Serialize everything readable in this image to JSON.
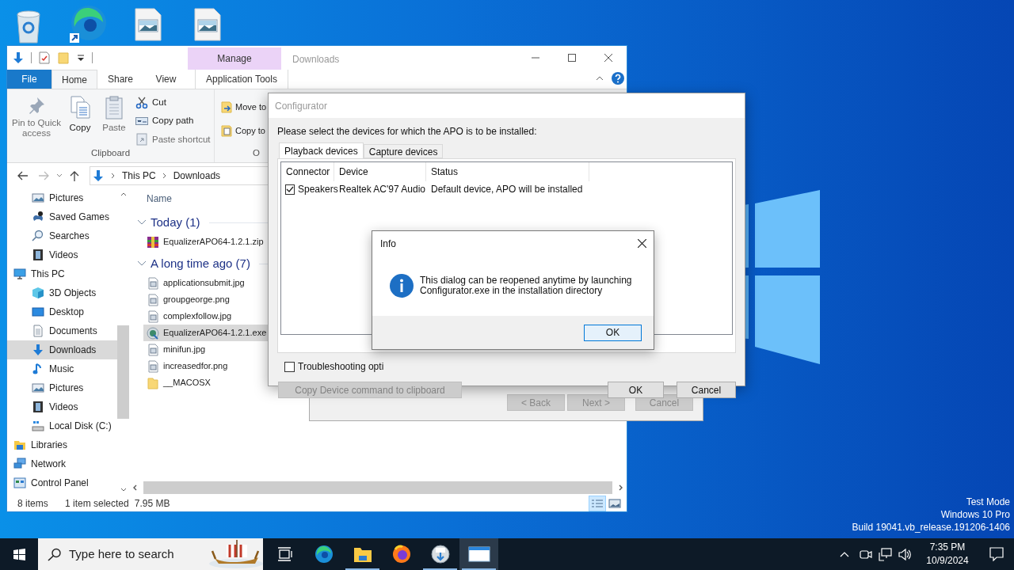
{
  "desktop": {
    "system_info": [
      "Test Mode",
      "Windows 10 Pro",
      "Build 19041.vb_release.191206-1406"
    ]
  },
  "explorer": {
    "title": "Downloads",
    "context_header": "Manage",
    "tabs": [
      {
        "label": "File",
        "kind": "file",
        "selected": false
      },
      {
        "label": "Home",
        "kind": "tab",
        "selected": true
      },
      {
        "label": "Share",
        "kind": "tab",
        "selected": false
      },
      {
        "label": "View",
        "kind": "tab",
        "selected": false
      },
      {
        "label": "Application Tools",
        "kind": "context",
        "selected": false
      }
    ],
    "ribbon": {
      "clipboard": {
        "label": "Clipboard",
        "commands": [
          {
            "label": "Pin to Quick access",
            "kind": "large",
            "disabled": true
          },
          {
            "label": "Copy",
            "kind": "large",
            "disabled": false
          },
          {
            "label": "Paste",
            "kind": "large",
            "disabled": true
          },
          {
            "label": "Cut",
            "kind": "small",
            "disabled": false
          },
          {
            "label": "Copy path",
            "kind": "small",
            "disabled": false
          },
          {
            "label": "Paste shortcut",
            "kind": "small",
            "disabled": true
          }
        ]
      },
      "organize": {
        "label": "O",
        "commands": [
          {
            "label": "Move to",
            "disabled": false
          },
          {
            "label": "Copy to",
            "disabled": false
          }
        ]
      }
    },
    "address": [
      "This PC",
      "Downloads"
    ],
    "nav": {
      "items_under_hidden_parent": [
        {
          "label": "Pictures",
          "selected": false
        },
        {
          "label": "Saved Games",
          "selected": false
        },
        {
          "label": "Searches",
          "selected": false
        },
        {
          "label": "Videos",
          "selected": false
        }
      ],
      "items": [
        {
          "label": "This PC",
          "selected": false,
          "children": [
            {
              "label": "3D Objects",
              "selected": false
            },
            {
              "label": "Desktop",
              "selected": false
            },
            {
              "label": "Documents",
              "selected": false
            },
            {
              "label": "Downloads",
              "selected": true
            },
            {
              "label": "Music",
              "selected": false
            },
            {
              "label": "Pictures",
              "selected": false
            },
            {
              "label": "Videos",
              "selected": false
            },
            {
              "label": "Local Disk (C:)",
              "selected": false
            }
          ]
        },
        {
          "label": "Libraries",
          "selected": false
        },
        {
          "label": "Network",
          "selected": false
        },
        {
          "label": "Control Panel",
          "selected": false
        }
      ]
    },
    "file_list": {
      "column": "Name",
      "groups": [
        {
          "title": "Today (1)",
          "expanded": true,
          "files": [
            {
              "name": "EqualizerAPO64-1.2.1.zip",
              "kind": "archive",
              "selected": false
            }
          ]
        },
        {
          "title": "A long time ago (7)",
          "expanded": true,
          "files": [
            {
              "name": "applicationsubmit.jpg",
              "kind": "image",
              "selected": false
            },
            {
              "name": "groupgeorge.png",
              "kind": "image",
              "selected": false
            },
            {
              "name": "complexfollow.jpg",
              "kind": "image",
              "selected": false
            },
            {
              "name": "EqualizerAPO64-1.2.1.exe",
              "kind": "installer",
              "selected": true
            },
            {
              "name": "minifun.jpg",
              "kind": "image",
              "selected": false
            },
            {
              "name": "increasedfor.png",
              "kind": "image",
              "selected": false
            },
            {
              "name": "__MACOSX",
              "kind": "folder",
              "selected": false
            }
          ]
        }
      ]
    },
    "status_bar": {
      "count": "8 items",
      "selection": "1 item selected",
      "size": "7.95 MB"
    }
  },
  "installer": {
    "buttons": [
      {
        "label": "< Back",
        "disabled": true
      },
      {
        "label": "Next >",
        "disabled": true
      },
      {
        "label": "Cancel",
        "disabled": true
      }
    ]
  },
  "configurator": {
    "title": "Configurator",
    "prompt": "Please select the devices for which the APO is to be installed:",
    "tabs": [
      {
        "label": "Playback devices",
        "selected": true
      },
      {
        "label": "Capture devices",
        "selected": false
      }
    ],
    "columns": [
      "Connector",
      "Device",
      "Status"
    ],
    "rows": [
      {
        "checked": true,
        "connector": "Speakers",
        "device": "Realtek AC'97 Audio",
        "status": "Default device, APO will be installed"
      }
    ],
    "troubleshooting": {
      "label": "Troubleshooting opti",
      "checked": false
    },
    "buttons": [
      {
        "label": "Copy Device command to clipboard",
        "disabled": true
      },
      {
        "label": "OK",
        "disabled": false
      },
      {
        "label": "Cancel",
        "disabled": false
      }
    ]
  },
  "info_dialog": {
    "title": "Info",
    "message": "This dialog can be reopened anytime by launching Configurator.exe in the installation directory",
    "button": "OK"
  },
  "taskbar": {
    "search_placeholder": "Type here to search",
    "apps": [
      {
        "running": false,
        "active": false
      },
      {
        "running": false,
        "active": false
      },
      {
        "running": true,
        "active": false
      },
      {
        "running": false,
        "active": false
      },
      {
        "running": true,
        "active": false
      },
      {
        "running": true,
        "active": true
      }
    ],
    "time": "7:35 PM",
    "date": "10/9/2024"
  }
}
